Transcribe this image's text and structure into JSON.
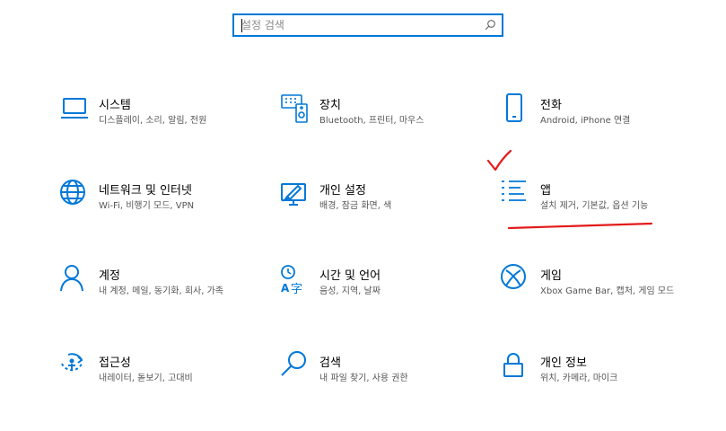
{
  "search": {
    "placeholder": "설정 검색"
  },
  "tiles": [
    {
      "title": "시스템",
      "desc": "디스플레이, 소리, 알림, 전원",
      "icon": "laptop-icon"
    },
    {
      "title": "장치",
      "desc": "Bluetooth, 프린터, 마우스",
      "icon": "keyboard-speaker-icon"
    },
    {
      "title": "전화",
      "desc": "Android, iPhone 연결",
      "icon": "phone-icon"
    },
    {
      "title": "네트워크 및 인터넷",
      "desc": "Wi-Fi, 비행기 모드, VPN",
      "icon": "globe-icon"
    },
    {
      "title": "개인 설정",
      "desc": "배경, 잠금 화면, 색",
      "icon": "paintbrush-screen-icon"
    },
    {
      "title": "앱",
      "desc": "설치 제거, 기본값, 옵션 기능",
      "icon": "app-list-icon"
    },
    {
      "title": "계정",
      "desc": "내 계정, 메일, 동기화, 회사, 가족",
      "icon": "person-icon"
    },
    {
      "title": "시간 및 언어",
      "desc": "음성, 지역, 날짜",
      "icon": "time-language-icon"
    },
    {
      "title": "게임",
      "desc": "Xbox Game Bar, 캡처, 게임 모드",
      "icon": "xbox-icon"
    },
    {
      "title": "접근성",
      "desc": "내레이터, 돋보기, 고대비",
      "icon": "accessibility-icon"
    },
    {
      "title": "검색",
      "desc": "내 파일 찾기, 사용 권한",
      "icon": "search-magnifier-icon"
    },
    {
      "title": "개인 정보",
      "desc": "위치, 카메라, 마이크",
      "icon": "lock-icon"
    }
  ],
  "annotation": {
    "color": "#e31b1b",
    "marks": [
      "checkmark-annotation",
      "underline-annotation"
    ]
  },
  "colors": {
    "accent": "#0078d7",
    "description_text": "#555555"
  }
}
